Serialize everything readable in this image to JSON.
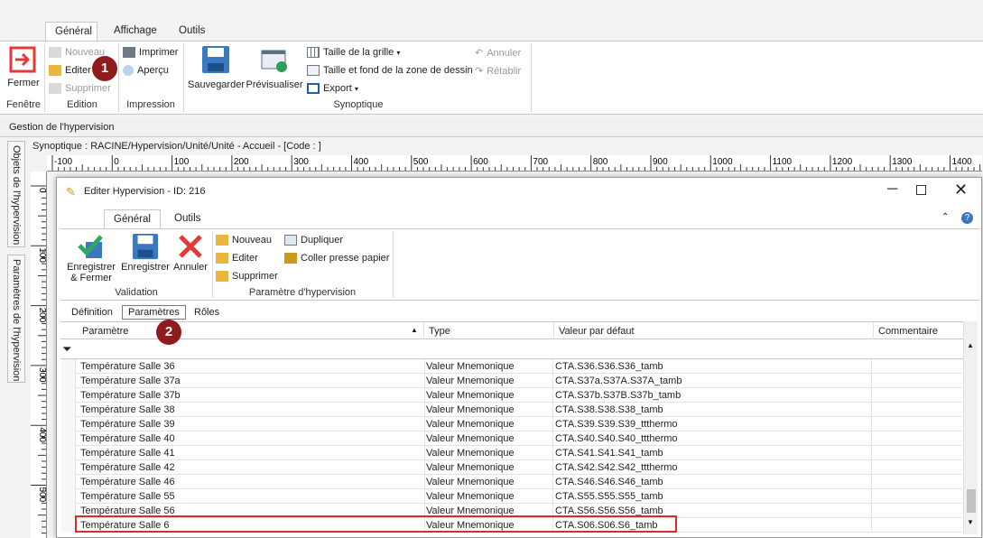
{
  "ribbon": {
    "tabs": [
      "Général",
      "Affichage",
      "Outils"
    ],
    "fenetre": {
      "close_label": "Fermer",
      "group_label": "Fenêtre"
    },
    "edition": {
      "new_label": "Nouveau",
      "edit_label": "Editer",
      "delete_label": "Supprimer",
      "group_label": "Edition"
    },
    "impression": {
      "print_label": "Imprimer",
      "preview_label": "Aperçu",
      "group_label": "Impression"
    },
    "synoptique": {
      "save_label": "Sauvegarder",
      "previz_label": "Prévisualiser",
      "grid_label": "Taille de la grille",
      "size_bg_label": "Taille et fond de la zone de dessin",
      "export_label": "Export",
      "undo_label": "Annuler",
      "redo_label": "Rétablir",
      "group_label": "Synoptique"
    }
  },
  "panel": {
    "title": "Gestion de l'hypervision",
    "synoptique_path": "Synoptique : RACINE/Hypervision/Unité/Unité - Accueil - [Code : ]",
    "side_tabs": [
      "Objets de l'hypervision",
      "Paramètres de l'hypervision"
    ]
  },
  "ruler": {
    "h_labels": [
      "-100",
      "0",
      "100",
      "200",
      "300",
      "400",
      "500",
      "600",
      "700",
      "800",
      "900",
      "1000",
      "1100",
      "1200",
      "1300",
      "1400"
    ],
    "v_labels": [
      "0",
      "100",
      "200",
      "300",
      "400",
      "500"
    ]
  },
  "dialog": {
    "title": "Editer Hypervision - ID: 216",
    "tabs": [
      "Général",
      "Outils"
    ],
    "validation": {
      "save_close_label": "Enregistrer\n& Fermer",
      "save_label": "Enregistrer",
      "cancel_label": "Annuler",
      "group_label": "Validation"
    },
    "params": {
      "new_label": "Nouveau",
      "edit_label": "Editer",
      "delete_label": "Supprimer",
      "duplicate_label": "Dupliquer",
      "paste_label": "Coller presse papier",
      "group_label": "Paramètre d'hypervision"
    },
    "sub_tabs": [
      "Définition",
      "Paramètres",
      "Rôles"
    ],
    "grid": {
      "headers": [
        "Paramètre",
        "Type",
        "Valeur par défaut",
        "Commentaire"
      ],
      "rows": [
        {
          "param": "Température Salle 36",
          "type": "Valeur Mnemonique",
          "value": "CTA.S36.S36.S36_tamb",
          "comment": ""
        },
        {
          "param": "Température Salle 37a",
          "type": "Valeur Mnemonique",
          "value": "CTA.S37a.S37A.S37A_tamb",
          "comment": ""
        },
        {
          "param": "Température Salle 37b",
          "type": "Valeur Mnemonique",
          "value": "CTA.S37b.S37B.S37b_tamb",
          "comment": ""
        },
        {
          "param": "Température Salle 38",
          "type": "Valeur Mnemonique",
          "value": "CTA.S38.S38.S38_tamb",
          "comment": ""
        },
        {
          "param": "Température Salle 39",
          "type": "Valeur Mnemonique",
          "value": "CTA.S39.S39.S39_ttthermo",
          "comment": ""
        },
        {
          "param": "Température Salle 40",
          "type": "Valeur Mnemonique",
          "value": "CTA.S40.S40.S40_ttthermo",
          "comment": ""
        },
        {
          "param": "Température Salle 41",
          "type": "Valeur Mnemonique",
          "value": "CTA.S41.S41.S41_tamb",
          "comment": ""
        },
        {
          "param": "Température Salle 42",
          "type": "Valeur Mnemonique",
          "value": "CTA.S42.S42.S42_ttthermo",
          "comment": ""
        },
        {
          "param": "Température Salle 46",
          "type": "Valeur Mnemonique",
          "value": "CTA.S46.S46.S46_tamb",
          "comment": ""
        },
        {
          "param": "Température Salle 55",
          "type": "Valeur Mnemonique",
          "value": "CTA.S55.S55.S55_tamb",
          "comment": ""
        },
        {
          "param": "Température Salle 56",
          "type": "Valeur Mnemonique",
          "value": "CTA.S56.S56.S56_tamb",
          "comment": ""
        },
        {
          "param": "Température Salle 6",
          "type": "Valeur Mnemonique",
          "value": "CTA.S06.S06.S6_tamb",
          "comment": ""
        }
      ]
    }
  },
  "markers": [
    "1",
    "2"
  ],
  "colors": {
    "highlight": "#d32f2f",
    "marker": "#8e1c1c",
    "accent": "#1f5fa8"
  }
}
